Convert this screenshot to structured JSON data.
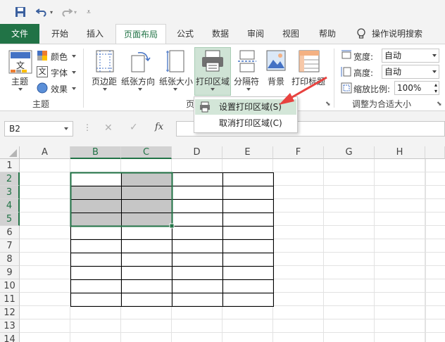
{
  "qat": {
    "save_icon": "save-icon",
    "undo_icon": "undo-icon",
    "redo_icon": "redo-icon",
    "customize_icon": "customize-qat-icon"
  },
  "tabs": [
    {
      "label": "文件"
    },
    {
      "label": "开始"
    },
    {
      "label": "插入"
    },
    {
      "label": "页面布局"
    },
    {
      "label": "公式"
    },
    {
      "label": "数据"
    },
    {
      "label": "审阅"
    },
    {
      "label": "视图"
    },
    {
      "label": "帮助"
    },
    {
      "label": "操作说明搜索"
    }
  ],
  "ribbon": {
    "theme": {
      "label": "主题",
      "colors": "颜色",
      "fonts": "字体",
      "effects": "效果",
      "group": "主题"
    },
    "page_setup": {
      "margins": "页边距",
      "orientation": "纸张方向",
      "size": "纸张大小",
      "print_area": "打印区域",
      "breaks": "分隔符",
      "background": "背景",
      "print_titles": "打印标题",
      "group_partial": "页"
    },
    "scale": {
      "width_label": "宽度:",
      "width_value": "自动",
      "height_label": "高度:",
      "height_value": "自动",
      "scale_label": "缩放比例:",
      "scale_value": "100%",
      "group": "调整为合适大小"
    }
  },
  "menu": {
    "items": [
      {
        "label": "设置打印区域(S)"
      },
      {
        "label": "取消打印区域(C)"
      }
    ]
  },
  "formula_bar": {
    "name_box": "B2",
    "fx": "fx",
    "value": ""
  },
  "columns": [
    "A",
    "B",
    "C",
    "D",
    "E",
    "F",
    "G",
    "H"
  ],
  "rows": [
    "1",
    "2",
    "3",
    "4",
    "5",
    "6",
    "7",
    "8",
    "9",
    "10",
    "11",
    "12",
    "13",
    "14"
  ],
  "colors": {
    "accent": "#217346",
    "selection_fill": "#c6c6c6",
    "arrow": "#e8423f"
  }
}
